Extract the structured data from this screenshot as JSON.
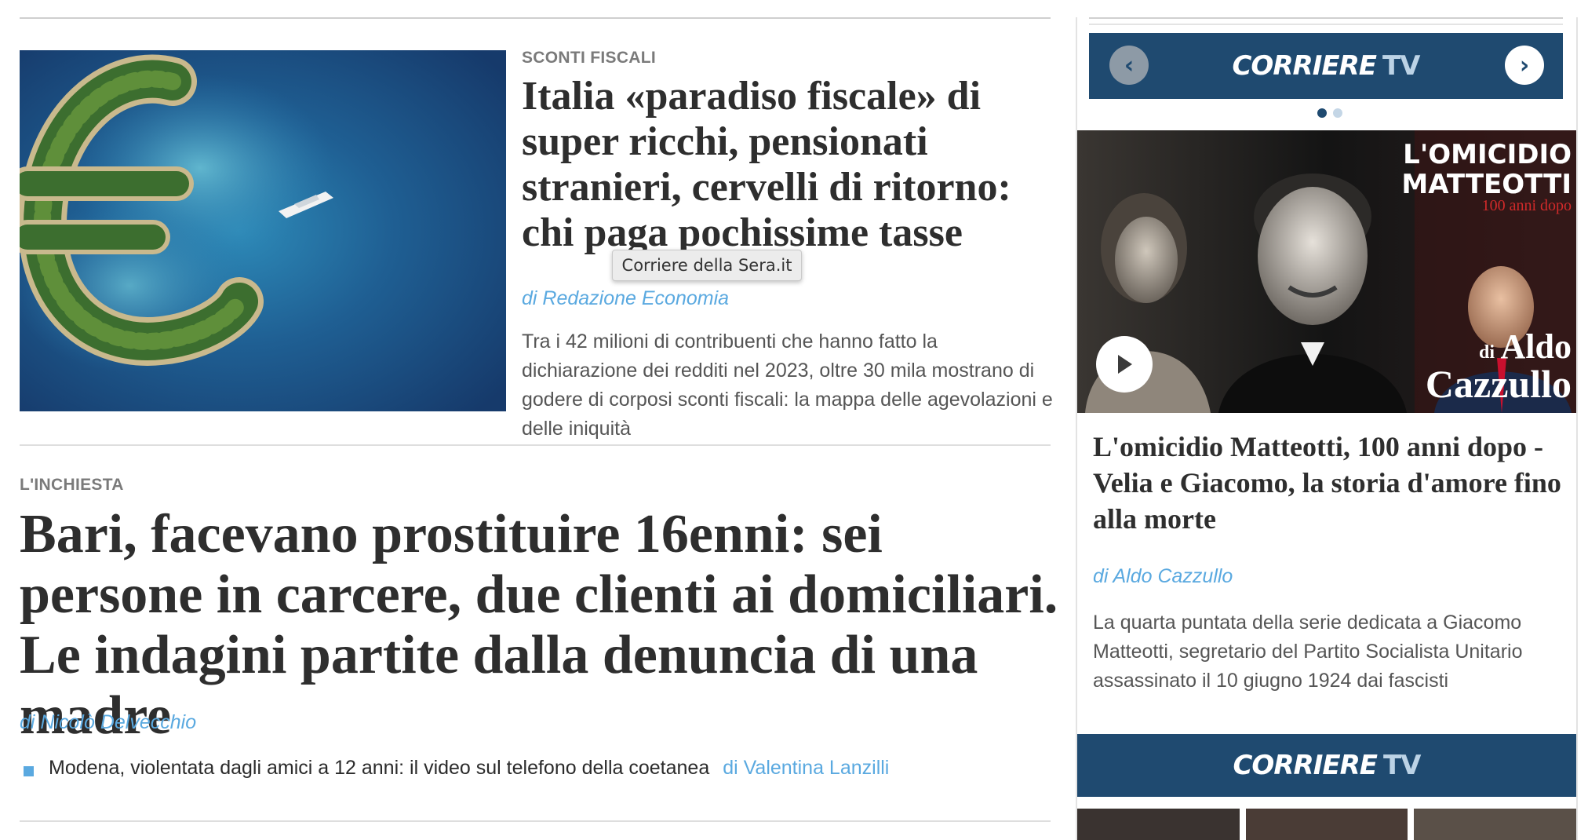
{
  "lead_story": {
    "kicker": "SCONTI FISCALI",
    "title": "Italia «paradiso fiscale» di super ricchi, pensionati stranieri, cervelli di ritorno: chi paga pochissime tasse",
    "author": "di Redazione Economia",
    "summary": "Tra i 42 milioni di contribuenti che hanno fatto la dichiarazione dei redditi nel 2023, oltre 30 mila mostrano di godere di corposi sconti fiscali: la mappa delle agevolazioni e delle iniquità"
  },
  "tooltip": "Corriere della Sera.it",
  "second_story": {
    "kicker": "L'INCHIESTA",
    "title": "Bari, facevano prostituire 16enni: sei persone in carcere, due clienti ai domiciliari. Le indagini partite dalla denuncia di una madre",
    "author": "di Nicolò Delvecchio",
    "related": {
      "title": "Modena, violentata dagli amici a 12 anni: il video sul telefono della coetanea",
      "author": "di Valentina Lanzilli"
    }
  },
  "sidebar": {
    "brand_main": "CORRIERE",
    "brand_tv": "TV",
    "prev_icon": "‹",
    "next_icon": "›",
    "video_overlay": {
      "title_line1": "L'OMICIDIO",
      "title_line2": "MATTEOTTI",
      "subtitle": "100 anni dopo",
      "di": "di",
      "author_first": "Aldo",
      "author_last": "Cazzullo"
    },
    "video_title": "L'omicidio Matteotti, 100 anni dopo - Velia e Giacomo, la storia d'amore fino alla morte",
    "video_author": "di Aldo Cazzullo",
    "video_summary": "La quarta puntata della serie dedicata a Giacomo Matteotti, segretario del Partito Socialista Unitario assassinato il 10 giugno 1924 dai fascisti"
  },
  "colors": {
    "accent_blue": "#5aa9e0",
    "tv_bar": "#1f4a70",
    "text": "#2e2e2e"
  }
}
